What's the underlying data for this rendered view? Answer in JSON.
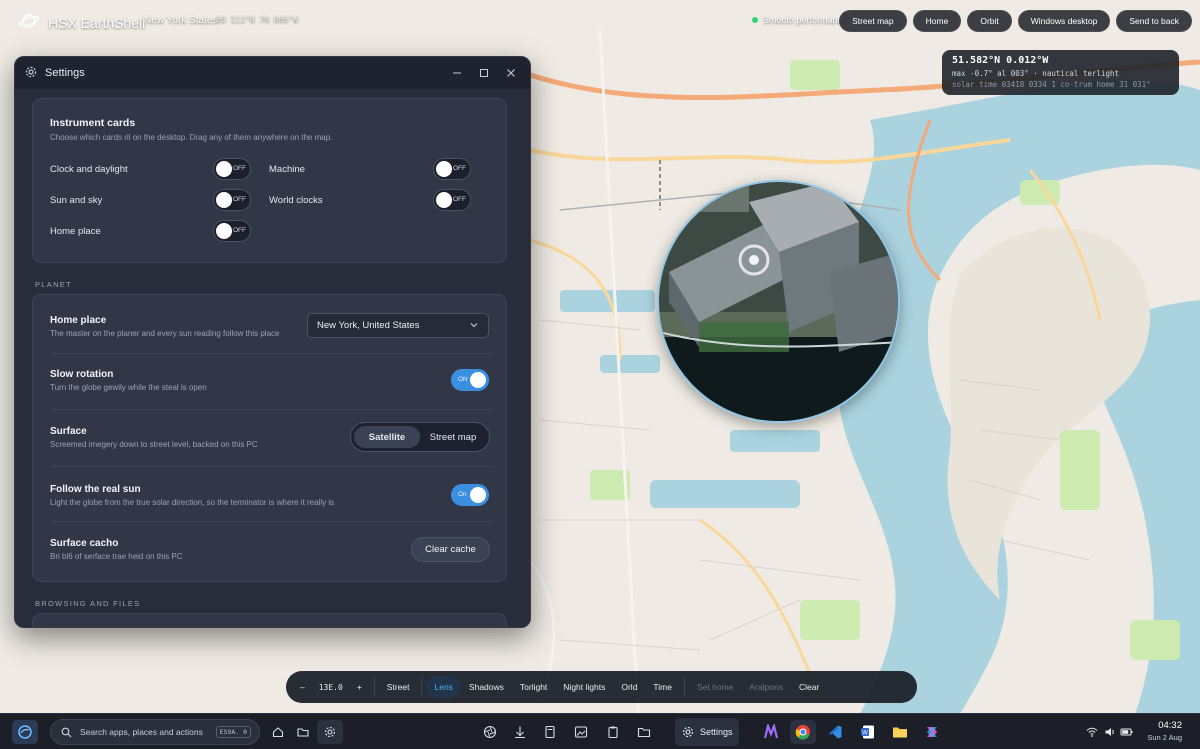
{
  "app": {
    "title": "HSX EarthShell",
    "place": "New York States",
    "coords": "00 111°N 7N 066°W",
    "performance": "Smooth performance"
  },
  "top_buttons": [
    "Street map",
    "Home",
    "Orbit",
    "Windows desktop",
    "Send to back"
  ],
  "coord_card": {
    "position": "51.582°N 0.012°W",
    "line2": "max -0.7° al 003° · nautical terlight",
    "line3": "solar time 03418  0334 1 co-trum home 31 031°"
  },
  "settings": {
    "title": "Settings",
    "instrument_cards": {
      "title": "Instrument cards",
      "subtitle": "Choose which cards ril on the desktop. Drag any of them anywhere on the map.",
      "items": [
        {
          "label": "Clock and daylight",
          "state": "OFF"
        },
        {
          "label": "Machine",
          "state": "OFF"
        },
        {
          "label": "Sun and sky",
          "state": "OFF"
        },
        {
          "label": "World clocks",
          "state": "OFF"
        },
        {
          "label": "Home place",
          "state": "OFF"
        }
      ]
    },
    "planet_label": "PLANET",
    "planet": {
      "home_place": {
        "title": "Home place",
        "subtitle": "The master on the planer and every sun reading follow this place",
        "value": "New York, United States"
      },
      "slow_rotation": {
        "title": "Slow rotation",
        "subtitle": "Turn the globe gewily while the steal is open",
        "state": "ON"
      },
      "surface": {
        "title": "Surface",
        "subtitle": "Screemed imegery down to street level, backed on this PC",
        "options": [
          "Satellite",
          "Street map"
        ],
        "selected": "Satellite"
      },
      "follow_sun": {
        "title": "Follow the real sun",
        "subtitle": "Light the globe from the true solar direction, so the terminator is where it really is",
        "state": "On"
      },
      "cache": {
        "title": "Surface cacho",
        "subtitle": "Bri bl6 of serface trae heid on this PC",
        "button": "Clear cache"
      }
    },
    "browsing_label": "BROWSING AND FILES"
  },
  "toolbar": {
    "zoom_minus": "–",
    "zoom_value": "13E.0",
    "zoom_plus": "+",
    "items": [
      "Street",
      "Lens",
      "Shadows",
      "Torlight",
      "Night lights",
      "Orld",
      "Time"
    ],
    "active": "Lens",
    "dim_items": [
      "Set home",
      "Aralpons"
    ],
    "clear": "Clear"
  },
  "taskbar": {
    "search_placeholder": "Search apps, places and actions",
    "search_shortcut": "ES9A. 0",
    "settings_label": "Settings",
    "time": "04:32",
    "date": "Sun 2 Aug"
  },
  "colors": {
    "accent": "#3b8fe0",
    "lens_accent": "#4cb1f0",
    "water": "#aad3df",
    "land": "#f2efe9",
    "park": "#cdebb0",
    "perf_ok": "#34d27a"
  }
}
